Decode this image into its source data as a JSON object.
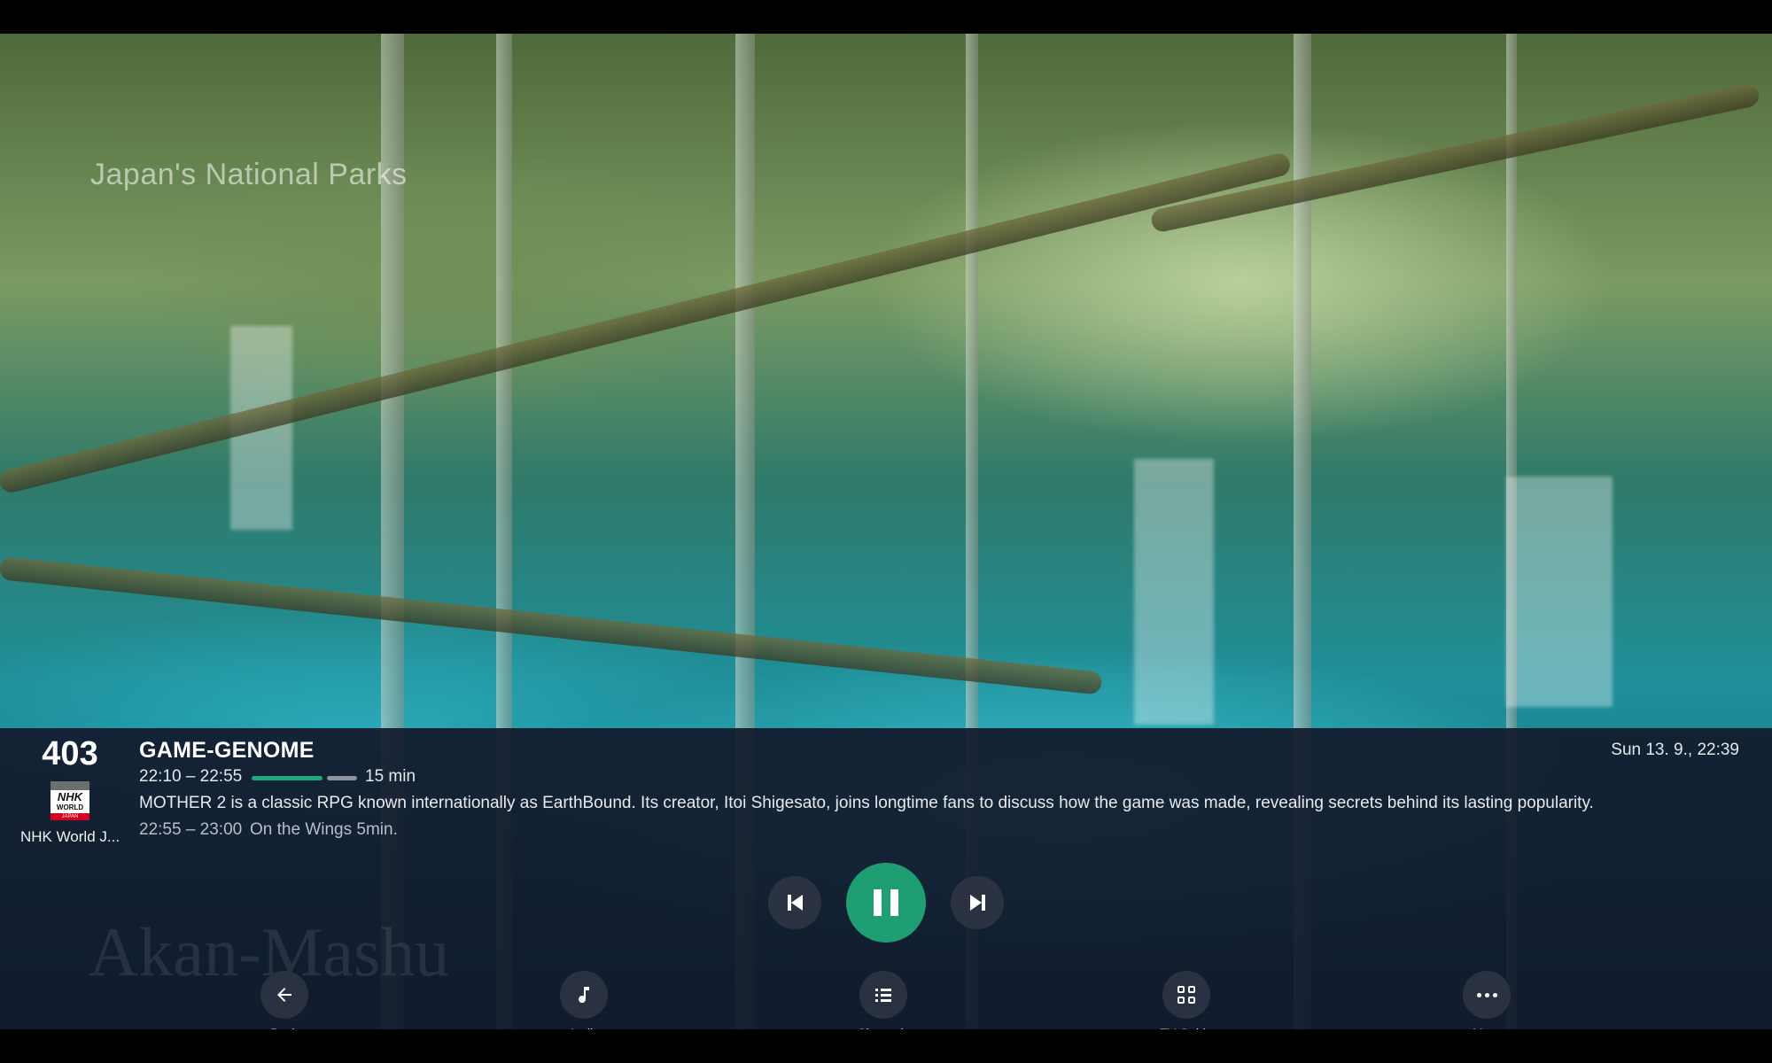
{
  "video": {
    "caption": "Japan's National Parks",
    "watermark": "Akan-Mashu"
  },
  "channel": {
    "number": "403",
    "name": "NHK World J...",
    "logo": {
      "line1": "NHK",
      "line2": "WORLD",
      "line3": "JAPAN"
    }
  },
  "program": {
    "title": "GAME-GENOME",
    "time_range": "22:10 – 22:55",
    "progress_fraction": 0.7,
    "remaining": "15 min",
    "description": "MOTHER 2 is a classic RPG known internationally as EarthBound. Its creator, Itoi Shigesato, joins longtime fans to discuss how the game was made, revealing secrets behind its lasting popularity."
  },
  "next_program": {
    "time": "22:55 – 23:00",
    "title": "On the Wings 5min."
  },
  "clock": "Sun 13. 9., 22:39",
  "controls": {
    "previous_icon": "skip-previous-icon",
    "pause_icon": "pause-icon",
    "next_icon": "skip-next-icon",
    "accent_color": "#1f9e74"
  },
  "actions": [
    {
      "label": "Back",
      "icon": "arrow-left-icon"
    },
    {
      "label": "Audio",
      "icon": "music-note-icon"
    },
    {
      "label": "Channels",
      "icon": "list-icon"
    },
    {
      "label": "TV Guide",
      "icon": "grid-icon"
    },
    {
      "label": "More",
      "icon": "more-horizontal-icon"
    }
  ]
}
